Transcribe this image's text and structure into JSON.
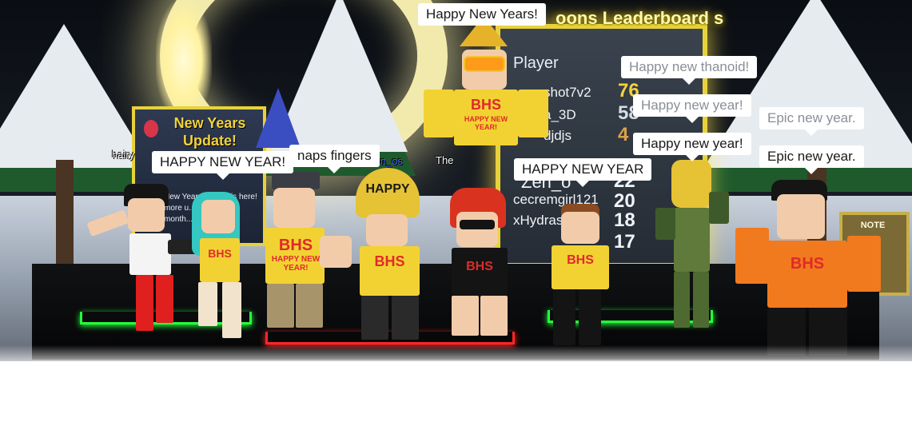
{
  "scene": {
    "description_label": "roblox-new-years-event",
    "accent_color": "#e8d23c",
    "pad_green": "#26ff3c",
    "pad_red": "#ff2626"
  },
  "leaderboard": {
    "title": "oons Leaderboard s",
    "header": "Player",
    "rows": [
      {
        "name": "shot7v2",
        "score": "76"
      },
      {
        "name": "a_3D",
        "score": "58"
      },
      {
        "name": "djdjs",
        "score": "4"
      },
      {
        "name": "Zen_o",
        "score": "22"
      },
      {
        "name": "cecremgirl121",
        "score": "20"
      },
      {
        "name": "xHydrasu",
        "score": "18"
      },
      {
        "name": "",
        "score": "17"
      }
    ]
  },
  "update_sign": {
    "title_line1": "New Years",
    "title_line2": "Update!",
    "body": "New Years update is here! more u... build thro... month..."
  },
  "note_sign": {
    "label": "NOTE"
  },
  "nametags": {
    "zen": "zen_os",
    "hairy": "hairy",
    "the": "The"
  },
  "bubbles": [
    {
      "id": "top",
      "text": "Happy New Years!"
    },
    {
      "id": "thanoid",
      "text": "Happy new thanoid!"
    },
    {
      "id": "newyear1",
      "text": "Happy new year!"
    },
    {
      "id": "epic1",
      "text": "Epic new year."
    },
    {
      "id": "newyear2",
      "text": "Happy new year!"
    },
    {
      "id": "epic2",
      "text": "Epic new year."
    },
    {
      "id": "caps",
      "text": "HAPPY NEW YEAR!"
    },
    {
      "id": "snaps",
      "text": "naps fingers"
    },
    {
      "id": "happy-no-bang",
      "text": "HAPPY NEW YEAR"
    }
  ],
  "shirts": {
    "bhs": "BHS",
    "happy_new_year": "HAPPY NEW YEAR!",
    "hat_text": "HAPPY"
  }
}
